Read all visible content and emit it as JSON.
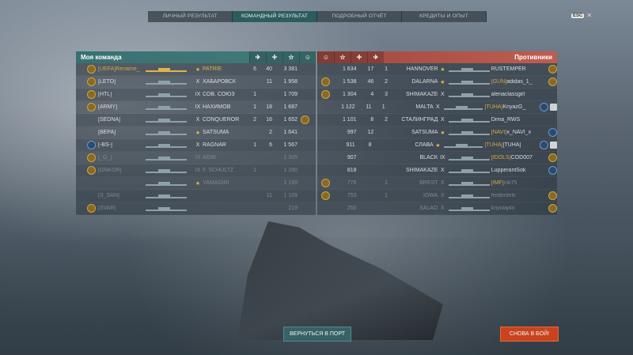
{
  "tabs": [
    "ЛИЧНЫЙ РЕЗУЛЬТАТ",
    "КОМАНДНЫЙ РЕЗУЛЬТАТ",
    "ПОДРОБНЫЙ ОТЧЁТ",
    "КРЕДИТЫ И ОПЫТ"
  ],
  "active_tab": 1,
  "esc": {
    "key": "ESC",
    "glyph": "✕"
  },
  "my_team": {
    "title": "Моя команда",
    "header_icons": [
      "plane-icon",
      "crosshair-icon",
      "star-icon",
      "achievement-icon"
    ],
    "header_glyphs": [
      "✈",
      "✛",
      "☆",
      "☺"
    ],
    "rows": [
      {
        "badge": "gold",
        "player": "[UEFA]Rename_",
        "tier": "★",
        "ship": "PATRIE",
        "kills": "6",
        "exp": "40",
        "score": "3 381",
        "ach": "",
        "highlight": true
      },
      {
        "badge": "gold",
        "player": "[LETO]",
        "tier": "X",
        "ship": "ХАБАРОВСК",
        "kills": "",
        "exp": "11",
        "score": "1 958",
        "ach": ""
      },
      {
        "badge": "gold",
        "player": "[HTL]",
        "tier": "IX",
        "ship": "СОВ. СОЮЗ",
        "kills": "1",
        "exp": "",
        "score": "1 709",
        "ach": ""
      },
      {
        "badge": "gold",
        "player": "[ARMY]",
        "tier": "IX",
        "ship": "НАХИМОВ",
        "kills": "1",
        "exp": "18",
        "score": "1 687",
        "ach": ""
      },
      {
        "badge": "none",
        "player": "[SEDNA]",
        "tier": "X",
        "ship": "CONQUEROR",
        "kills": "2",
        "exp": "16",
        "score": "1 652",
        "ach": "gold"
      },
      {
        "badge": "none",
        "player": "[ВЕРА]",
        "tier": "★",
        "ship": "SATSUMA",
        "kills": "",
        "exp": "2",
        "score": "1 641",
        "ach": ""
      },
      {
        "badge": "blue",
        "player": "[-BS-]",
        "tier": "X",
        "ship": "RAGNAR",
        "kills": "1",
        "exp": "6",
        "score": "1 567",
        "ach": ""
      },
      {
        "badge": "gold",
        "player": "[_G_]",
        "tier": "IX",
        "ship": "AGIR",
        "kills": "",
        "exp": "",
        "score": "1 305",
        "ach": "",
        "dim": true
      },
      {
        "badge": "gold",
        "player": "[GNKOR]",
        "tier": "IX",
        "ship": "F. SCHULTZ",
        "kills": "1",
        "exp": "",
        "score": "1 280",
        "ach": "",
        "dim": true
      },
      {
        "badge": "none",
        "player": "",
        "tier": "★",
        "ship": "YAMAGIRI",
        "kills": "",
        "exp": "",
        "score": "1 169",
        "ach": "",
        "dim": true
      },
      {
        "badge": "none",
        "player": "[S_SAN]",
        "tier": "",
        "ship": "",
        "kills": "",
        "exp": "11",
        "score": "1 109",
        "ach": "",
        "dim": true
      },
      {
        "badge": "gold",
        "player": "[SVAR]",
        "tier": "",
        "ship": "",
        "kills": "",
        "exp": "",
        "score": "219",
        "ach": "",
        "dim": true
      }
    ]
  },
  "enemies": {
    "title": "Противники",
    "header_icons": [
      "achievement-icon",
      "star-icon",
      "crosshair-icon",
      "plane-icon"
    ],
    "header_glyphs": [
      "☺",
      "☆",
      "✛",
      "✈"
    ],
    "rows": [
      {
        "ach": "",
        "score": "1 634",
        "exp": "17",
        "kills": "1",
        "ship": "HANNOVER",
        "tier": "★",
        "player": "RUSTEMPER",
        "clan": "",
        "badge": "gold",
        "badge2": ""
      },
      {
        "ach": "gold",
        "score": "1 538",
        "exp": "46",
        "kills": "2",
        "ship": "DALARNA",
        "tier": "★",
        "player": "adidas_1_",
        "clan": "[GUN]",
        "badge": "gold",
        "badge2": ""
      },
      {
        "ach": "gold",
        "score": "1 304",
        "exp": "4",
        "kills": "3",
        "ship": "SHIMAKAZE",
        "tier": "X",
        "player": "alenaclassgirl",
        "clan": "",
        "badge": "none",
        "badge2": ""
      },
      {
        "ach": "",
        "score": "1 122",
        "exp": "11",
        "kills": "1",
        "ship": "MALTA",
        "tier": "X",
        "player": "KnyazG_",
        "clan": "[TUHA]",
        "badge": "blue",
        "badge2": "square"
      },
      {
        "ach": "",
        "score": "1 101",
        "exp": "8",
        "kills": "2",
        "ship": "СТАЛИНГРАД",
        "tier": "X",
        "player": "Dima_RWS",
        "clan": "",
        "badge": "none",
        "badge2": ""
      },
      {
        "ach": "",
        "score": "997",
        "exp": "12",
        "kills": "",
        "ship": "SATSUMA",
        "tier": "★",
        "player": "x_NAVI_x",
        "clan": "[NAVI]",
        "badge": "blue",
        "badge2": ""
      },
      {
        "ach": "",
        "score": "911",
        "exp": "8",
        "kills": "",
        "ship": "СЛАВА",
        "tier": "★",
        "player": "[TUHA]",
        "clan": "[TUHA]",
        "badge": "blue",
        "badge2": "square"
      },
      {
        "ach": "",
        "score": "907",
        "exp": "",
        "kills": "",
        "ship": "BLACK",
        "tier": "IX",
        "player": "COD007",
        "clan": "[IDOLS]",
        "badge": "gold",
        "badge2": ""
      },
      {
        "ach": "",
        "score": "818",
        "exp": "",
        "kills": "",
        "ship": "SHIMAKAZE",
        "tier": "X",
        "player": "LupperantSok",
        "clan": "",
        "badge": "blue",
        "badge2": ""
      },
      {
        "ach": "gold",
        "score": "776",
        "exp": "",
        "kills": "1",
        "ship": "BREST",
        "tier": "X",
        "player": "nik75",
        "clan": "[IMF]",
        "badge": "none",
        "badge2": "",
        "dim": true
      },
      {
        "ach": "gold",
        "score": "753",
        "exp": "",
        "kills": "1",
        "ship": "IOWA",
        "tier": "X",
        "player": "fredenfels",
        "clan": "",
        "badge": "gold",
        "badge2": "",
        "dim": true
      },
      {
        "ach": "",
        "score": "250",
        "exp": "",
        "kills": "",
        "ship": "SALAO",
        "tier": "X",
        "player": "knyolaj4n",
        "clan": "",
        "badge": "gold",
        "badge2": "",
        "dim": true
      }
    ]
  },
  "buttons": {
    "port": "ВЕРНУТЬСЯ В ПОРТ",
    "battle": "СНОВА В БОЙ!"
  },
  "colors": {
    "ally": "#3c7c7c",
    "enemy": "#c8584a",
    "gold": "#e0b44a",
    "battle_button": "#c9441e"
  }
}
